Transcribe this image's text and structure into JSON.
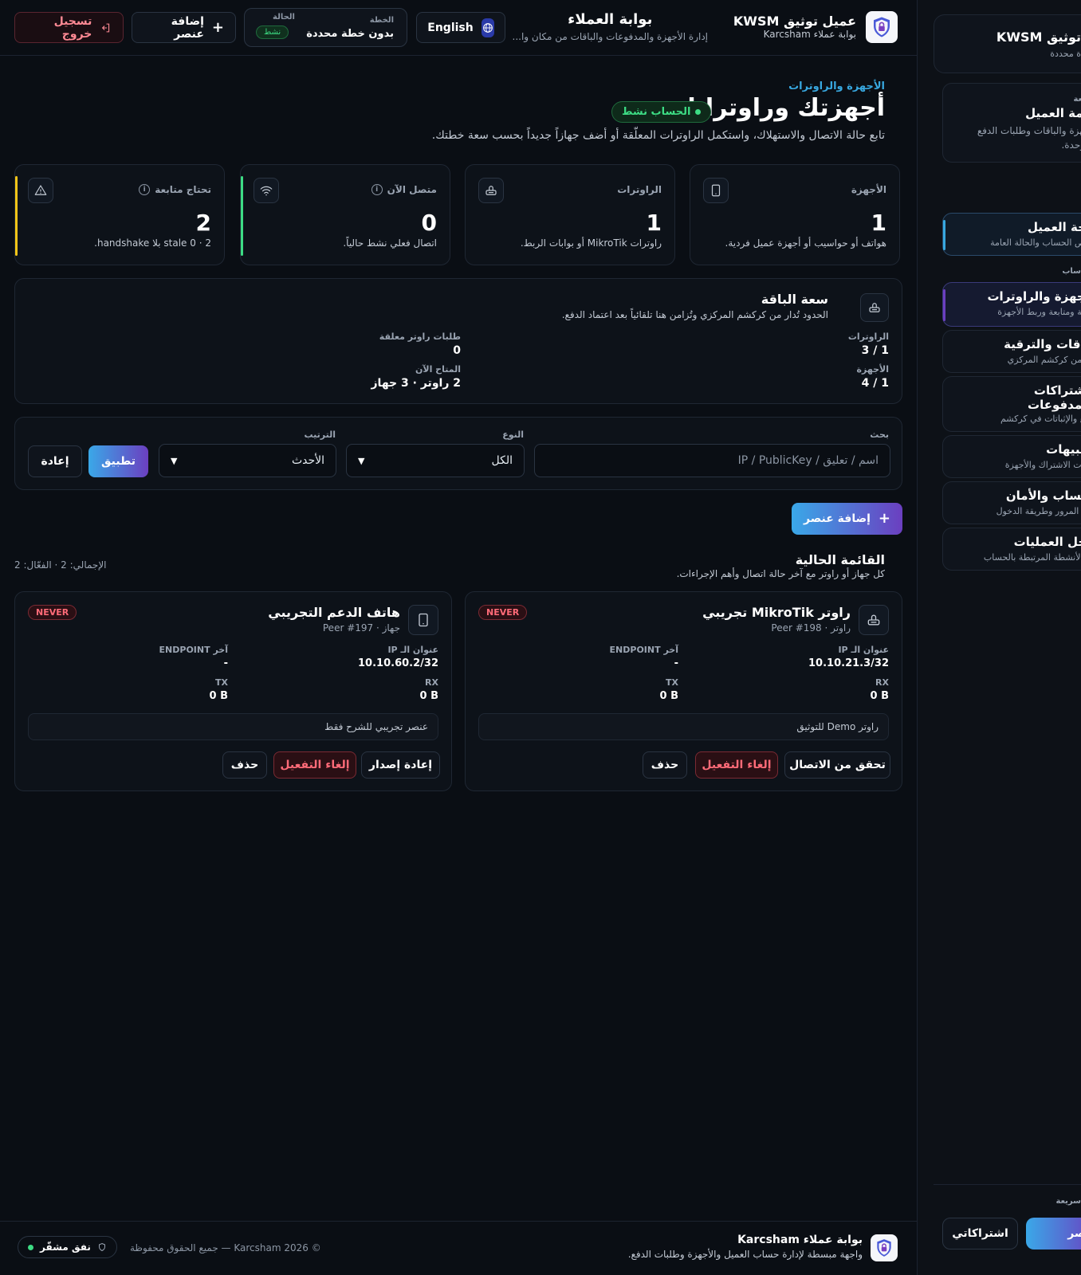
{
  "header": {
    "brand_name": "عميل توثيق KWSM",
    "brand_sub": "بوابة عملاء Karcsham",
    "portal_title": "بوابة العملاء",
    "portal_sub": "إدارة الأجهزة والمدفوعات والباقات من مكان وا...",
    "lang_label": "English",
    "plan_label": "الخطة",
    "plan_value": "بدون خطة محددة",
    "status_label": "الحالة",
    "status_value": "نشط",
    "add_label": "إضافة عنصر",
    "logout_label": "تسجيل خروج"
  },
  "page": {
    "breadcrumb": "الأجهزة والراوترات",
    "title": "أجهزتك وراوتراتك",
    "account_badge": "الحساب نشط",
    "subtitle": "تابع حالة الاتصال والاستهلاك، واستكمل الراوترات المعلّقة أو أضف جهازاً جديداً بحسب سعة خطتك."
  },
  "stats": [
    {
      "label": "الأجهزة",
      "value": "1",
      "desc": "هواتف أو حواسيب أو أجهزة عميل فردية.",
      "icon": "phone-icon"
    },
    {
      "label": "الراوترات",
      "value": "1",
      "desc": "راوترات MikroTik أو بوابات الربط.",
      "icon": "router-icon"
    },
    {
      "label": "متصل الآن",
      "value": "0",
      "desc": "اتصال فعلي نشط حالياً.",
      "icon": "wifi-icon"
    },
    {
      "label": "تحتاج متابعة",
      "value": "2",
      "desc": "2 · 0 stale بلا handshake.",
      "icon": "warning-icon"
    }
  ],
  "capacity": {
    "title": "سعة الباقة",
    "subtitle": "الحدود تُدار من كركشم المركزي وتُزامن هنا تلقائياً بعد اعتماد الدفع.",
    "routers_label": "الراوترات",
    "routers_value": "1 / 3",
    "devices_label": "الأجهزة",
    "devices_value": "1 / 4",
    "pending_label": "طلبات راوتر معلقة",
    "pending_value": "0",
    "available_label": "المتاح الآن",
    "available_value": "2 راوتر · 3 جهاز"
  },
  "filters": {
    "search_label": "بحث",
    "search_placeholder": "اسم / تعليق / IP / PublicKey",
    "type_label": "النوع",
    "type_value": "الكل",
    "sort_label": "الترتيب",
    "sort_value": "الأحدث",
    "apply_label": "تطبيق",
    "reset_label": "إعادة"
  },
  "add_button": "إضافة عنصر",
  "list": {
    "title": "القائمة الحالية",
    "subtitle": "كل جهاز أو راوتر مع آخر حالة اتصال وأهم الإجراءات.",
    "total": "الإجمالي: 2 · الفعّال: 2",
    "ip_label": "عنوان الـ IP",
    "endpoint_label": "آخر ENDPOINT",
    "rx_label": "RX",
    "tx_label": "TX",
    "items": [
      {
        "name": "راوتر MikroTik تجريبي",
        "meta": "راوتر · Peer #198",
        "status": "NEVER",
        "ip": "10.10.21.3/32",
        "endpoint": "-",
        "rx": "0 B",
        "tx": "0 B",
        "note": "راوتر Demo للتوثيق",
        "action1": "تحقق من الاتصال",
        "action2": "إلغاء التفعيل",
        "action3": "حذف",
        "icon": "router-icon"
      },
      {
        "name": "هاتف الدعم التجريبي",
        "meta": "جهاز · Peer #197",
        "status": "NEVER",
        "ip": "10.10.60.2/32",
        "endpoint": "-",
        "rx": "0 B",
        "tx": "0 B",
        "note": "عنصر تجريبي للشرح فقط",
        "action1": "إعادة إصدار",
        "action2": "إلغاء التفعيل",
        "action3": "حذف",
        "icon": "phone-icon"
      }
    ]
  },
  "footer": {
    "title": "بوابة عملاء Karcsham",
    "subtitle": "واجهة مبسطة لإدارة حساب العميل والأجهزة وطلبات الدفع.",
    "copyright": "© 2026 Karcsham — جميع الحقوق محفوظة",
    "tunnel": "نفق مشفّر"
  },
  "sidebar": {
    "brand_title": "توثيق KWSM",
    "brand_sub": "ة محددة",
    "quick_label": "سريعة",
    "service_title": "خدمة العميل",
    "service_text1": "للأجهزة والباقات وطلبات الدفع",
    "service_text2": "ة موحدة.",
    "section_label": "ساب",
    "items": [
      {
        "title": "لوحة العميل",
        "sub": "ملخص الحساب والحالة العامة"
      },
      {
        "title": "الأجهزة والراوترات",
        "sub": "إضافة ومتابعة وربط الأجهزة"
      },
      {
        "title": "الباقات والترقية",
        "sub": "تدار من كركشم المركزي"
      },
      {
        "title": "الاشتراكات والمدفوعات",
        "sub": "الدفع والإثباتات في كركشم"
      },
      {
        "title": "التنبيهات",
        "sub": "تنبيهات الاشتراك والأجهزة"
      },
      {
        "title": "الحساب والأمان",
        "sub": "كلمة المرور وطريقة الدخول"
      },
      {
        "title": "سجل العمليات",
        "sub": "آخر الأنشطة المرتبطة بالحساب"
      }
    ],
    "quick_bottom_label": "سريعة",
    "btn_subs": "اشتراكاتي",
    "btn_add": "عنصر"
  },
  "colors": {
    "accent_blue": "#38a8e0",
    "accent_purple": "#6b3fc0",
    "success": "#3ddc84",
    "danger": "#ff6b78",
    "warning": "#f5c518"
  }
}
